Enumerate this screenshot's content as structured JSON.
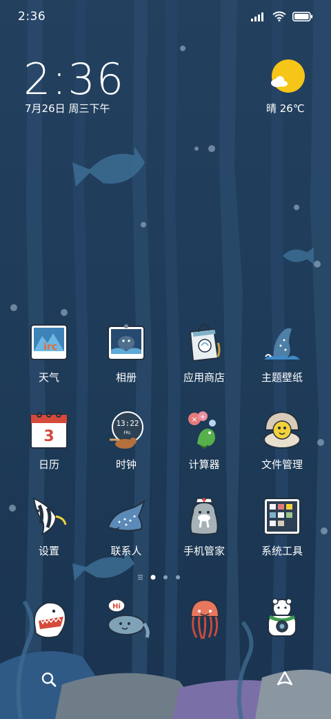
{
  "status_bar": {
    "time": "2:36",
    "icons": [
      "signal-icon",
      "wifi-icon",
      "battery-icon"
    ]
  },
  "clock_widget": {
    "time": "2:36",
    "date": "7月26日 周三下午"
  },
  "weather_widget": {
    "text": "晴 26℃",
    "icon": "sun-cloud-icon"
  },
  "apps": [
    {
      "label": "天气",
      "icon": "weather-app-icon"
    },
    {
      "label": "相册",
      "icon": "gallery-app-icon"
    },
    {
      "label": "应用商店",
      "icon": "app-store-icon"
    },
    {
      "label": "主题壁纸",
      "icon": "themes-app-icon"
    },
    {
      "label": "日历",
      "icon": "calendar-app-icon",
      "day": "3"
    },
    {
      "label": "时钟",
      "icon": "clock-app-icon",
      "clock_text": "13:22",
      "sub_text": "FRI."
    },
    {
      "label": "计算器",
      "icon": "calculator-app-icon"
    },
    {
      "label": "文件管理",
      "icon": "file-manager-icon"
    },
    {
      "label": "设置",
      "icon": "settings-app-icon"
    },
    {
      "label": "联系人",
      "icon": "contacts-app-icon"
    },
    {
      "label": "手机管家",
      "icon": "security-app-icon"
    },
    {
      "label": "系统工具",
      "icon": "system-tools-icon"
    }
  ],
  "dock": [
    {
      "icon": "phone-app-icon"
    },
    {
      "icon": "messages-app-icon",
      "badge_text": "Hi"
    },
    {
      "icon": "browser-app-icon"
    },
    {
      "icon": "camera-app-icon"
    }
  ],
  "page_indicator": {
    "pages": 3,
    "current": 1
  },
  "search_bar": {
    "left_icon": "search-icon",
    "right_icon": "assistant-icon"
  },
  "colors": {
    "background": "#1f3d5b",
    "text": "#ffffff",
    "sun": "#f5c518"
  }
}
